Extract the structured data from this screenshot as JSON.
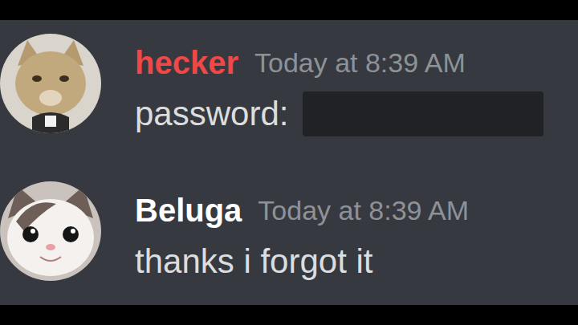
{
  "messages": [
    {
      "author": "hecker",
      "color": "#f04747",
      "time": "Today at 8:39 AM",
      "text": "password:",
      "spoiler": {
        "revealed": false
      }
    },
    {
      "author": "Beluga",
      "color": "#ffffff",
      "time": "Today at 8:39 AM",
      "text": "thanks i forgot it"
    }
  ]
}
